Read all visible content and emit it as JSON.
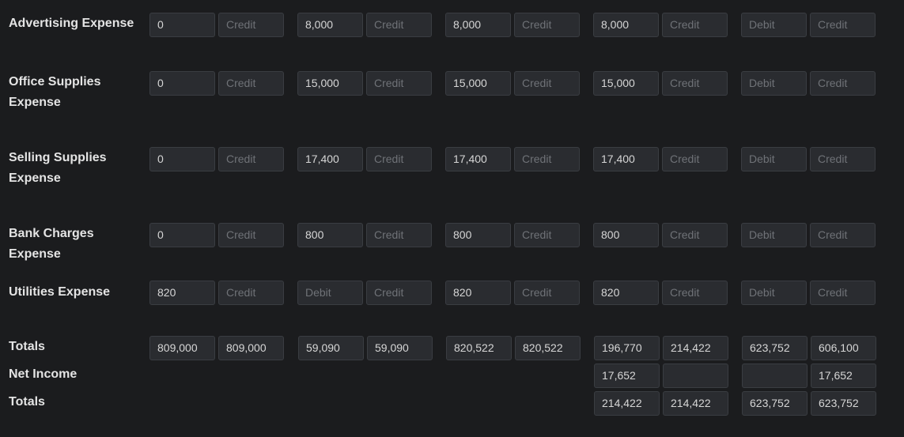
{
  "rows": [
    {
      "label": "Advertising Expense",
      "cells": [
        {
          "value": "0",
          "placeholder": ""
        },
        {
          "value": "",
          "placeholder": "Credit"
        },
        {
          "value": "8,000",
          "placeholder": ""
        },
        {
          "value": "",
          "placeholder": "Credit"
        },
        {
          "value": "8,000",
          "placeholder": ""
        },
        {
          "value": "",
          "placeholder": "Credit"
        },
        {
          "value": "8,000",
          "placeholder": ""
        },
        {
          "value": "",
          "placeholder": "Credit"
        },
        {
          "value": "",
          "placeholder": "Debit"
        },
        {
          "value": "",
          "placeholder": "Credit"
        }
      ]
    },
    {
      "label": "Office Supplies Expense",
      "cells": [
        {
          "value": "0",
          "placeholder": ""
        },
        {
          "value": "",
          "placeholder": "Credit"
        },
        {
          "value": "15,000",
          "placeholder": ""
        },
        {
          "value": "",
          "placeholder": "Credit"
        },
        {
          "value": "15,000",
          "placeholder": ""
        },
        {
          "value": "",
          "placeholder": "Credit"
        },
        {
          "value": "15,000",
          "placeholder": ""
        },
        {
          "value": "",
          "placeholder": "Credit"
        },
        {
          "value": "",
          "placeholder": "Debit"
        },
        {
          "value": "",
          "placeholder": "Credit"
        }
      ]
    },
    {
      "label": "Selling Supplies Expense",
      "cells": [
        {
          "value": "0",
          "placeholder": ""
        },
        {
          "value": "",
          "placeholder": "Credit"
        },
        {
          "value": "17,400",
          "placeholder": ""
        },
        {
          "value": "",
          "placeholder": "Credit"
        },
        {
          "value": "17,400",
          "placeholder": ""
        },
        {
          "value": "",
          "placeholder": "Credit"
        },
        {
          "value": "17,400",
          "placeholder": ""
        },
        {
          "value": "",
          "placeholder": "Credit"
        },
        {
          "value": "",
          "placeholder": "Debit"
        },
        {
          "value": "",
          "placeholder": "Credit"
        }
      ]
    },
    {
      "label": "Bank Charges Expense",
      "cells": [
        {
          "value": "0",
          "placeholder": ""
        },
        {
          "value": "",
          "placeholder": "Credit"
        },
        {
          "value": "800",
          "placeholder": ""
        },
        {
          "value": "",
          "placeholder": "Credit"
        },
        {
          "value": "800",
          "placeholder": ""
        },
        {
          "value": "",
          "placeholder": "Credit"
        },
        {
          "value": "800",
          "placeholder": ""
        },
        {
          "value": "",
          "placeholder": "Credit"
        },
        {
          "value": "",
          "placeholder": "Debit"
        },
        {
          "value": "",
          "placeholder": "Credit"
        }
      ]
    },
    {
      "label": "Utilities Expense",
      "cells": [
        {
          "value": "820",
          "placeholder": ""
        },
        {
          "value": "",
          "placeholder": "Credit"
        },
        {
          "value": "",
          "placeholder": "Debit"
        },
        {
          "value": "",
          "placeholder": "Credit"
        },
        {
          "value": "820",
          "placeholder": ""
        },
        {
          "value": "",
          "placeholder": "Credit"
        },
        {
          "value": "820",
          "placeholder": ""
        },
        {
          "value": "",
          "placeholder": "Credit"
        },
        {
          "value": "",
          "placeholder": "Debit"
        },
        {
          "value": "",
          "placeholder": "Credit"
        }
      ]
    }
  ],
  "totals": {
    "label": "Totals",
    "cells": [
      {
        "value": "809,000",
        "placeholder": ""
      },
      {
        "value": "809,000",
        "placeholder": ""
      },
      {
        "value": "59,090",
        "placeholder": ""
      },
      {
        "value": "59,090",
        "placeholder": ""
      },
      {
        "value": "820,522",
        "placeholder": ""
      },
      {
        "value": "820,522",
        "placeholder": ""
      },
      {
        "value": "196,770",
        "placeholder": ""
      },
      {
        "value": "214,422",
        "placeholder": ""
      },
      {
        "value": "623,752",
        "placeholder": ""
      },
      {
        "value": "606,100",
        "placeholder": ""
      }
    ]
  },
  "net_income": {
    "label": "Net Income",
    "cells": [
      {
        "value": "17,652",
        "placeholder": ""
      },
      {
        "value": "",
        "placeholder": ""
      },
      {
        "value": "",
        "placeholder": ""
      },
      {
        "value": "17,652",
        "placeholder": ""
      }
    ]
  },
  "final_totals": {
    "label": "Totals",
    "cells": [
      {
        "value": "214,422",
        "placeholder": ""
      },
      {
        "value": "214,422",
        "placeholder": ""
      },
      {
        "value": "623,752",
        "placeholder": ""
      },
      {
        "value": "623,752",
        "placeholder": ""
      }
    ]
  }
}
